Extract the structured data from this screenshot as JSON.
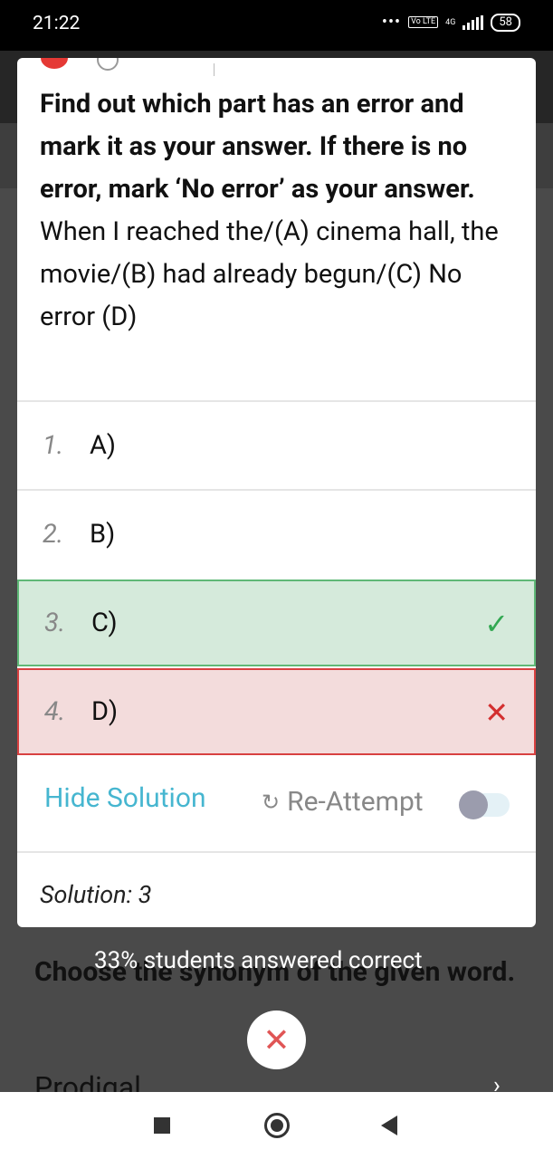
{
  "status_bar": {
    "time": "21:22",
    "dots": "•••",
    "volte": "Vo LTE",
    "network": "4G",
    "battery": "58"
  },
  "question": {
    "instruction": "Find out which part has an error and mark it as your answer. If there is no error, mark ‘No error’ as your answer.",
    "sentence": "When I reached the/(A) cinema hall, the movie/(B) had already begun/(C) No error (D)"
  },
  "options": [
    {
      "num": "1.",
      "label": "A)",
      "state": "none"
    },
    {
      "num": "2.",
      "label": "B)",
      "state": "none"
    },
    {
      "num": "3.",
      "label": "C)",
      "state": "correct",
      "mark": "✓"
    },
    {
      "num": "4.",
      "label": "D)",
      "state": "wrong",
      "mark": "✕"
    }
  ],
  "actions": {
    "hide_solution": "Hide Solution",
    "reattempt": "Re-Attempt",
    "reattempt_icon": "↻",
    "toggle_on": false
  },
  "solution": "Solution: 3",
  "background": {
    "next_question": "Choose the synonym of the given word.",
    "word": "Prodigal",
    "stats": "33% students answered correct",
    "close_icon": "✕",
    "next_icon": "›"
  },
  "colors": {
    "correct_bg": "#d5eadb",
    "correct_border": "#5fb877",
    "wrong_bg": "#f3dcdc",
    "wrong_border": "#d84040",
    "accent": "#46b6d0"
  }
}
